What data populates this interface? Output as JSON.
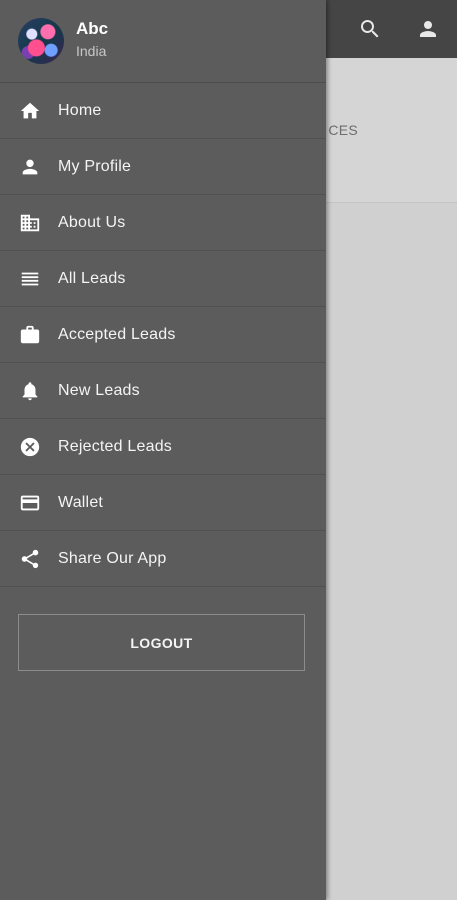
{
  "background": {
    "tab_text": "CES",
    "actions": [
      {
        "icon": "search-icon"
      },
      {
        "icon": "account-icon"
      }
    ]
  },
  "drawer": {
    "user": {
      "name": "Abc",
      "location": "India"
    },
    "items": [
      {
        "label": "Home",
        "icon": "home-icon"
      },
      {
        "label": "My Profile",
        "icon": "person-icon"
      },
      {
        "label": "About Us",
        "icon": "building-icon"
      },
      {
        "label": "All Leads",
        "icon": "list-icon"
      },
      {
        "label": "Accepted Leads",
        "icon": "briefcase-icon"
      },
      {
        "label": "New Leads",
        "icon": "bell-icon"
      },
      {
        "label": "Rejected Leads",
        "icon": "cancel-circle-icon"
      },
      {
        "label": "Wallet",
        "icon": "credit-card-icon"
      },
      {
        "label": "Share Our App",
        "icon": "share-icon"
      }
    ],
    "logout_label": "LOGOUT"
  },
  "colors": {
    "drawer_bg": "#5c5c5c",
    "app_bar_bg": "#454545",
    "scrim_bg": "#cfcfcf",
    "text": "#ffffff"
  }
}
